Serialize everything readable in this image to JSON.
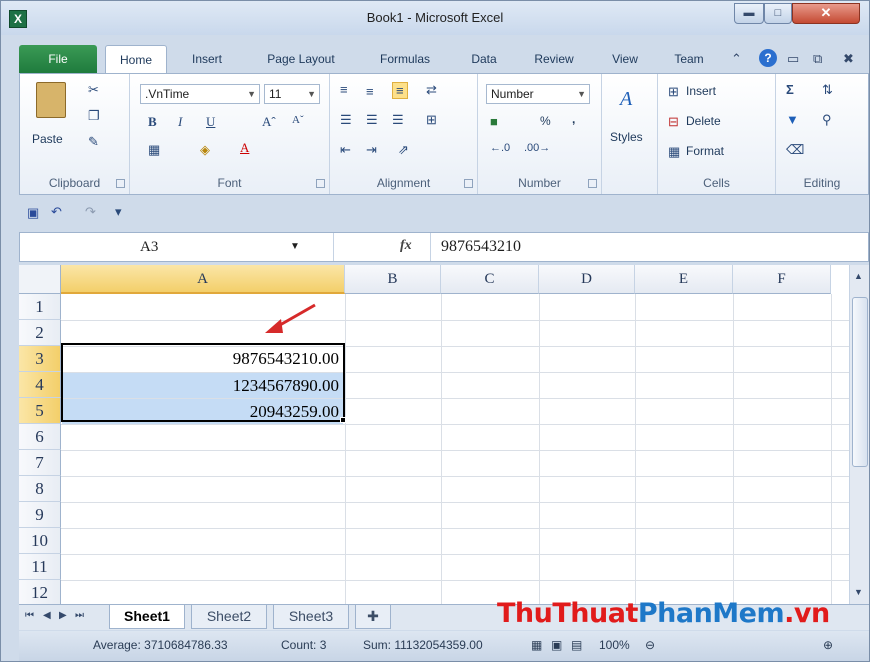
{
  "window": {
    "title": "Book1 - Microsoft Excel",
    "app_icon": "X"
  },
  "ribbon_tabs": [
    "File",
    "Home",
    "Insert",
    "Page Layout",
    "Formulas",
    "Data",
    "Review",
    "View",
    "Team"
  ],
  "ribbon": {
    "clipboard": {
      "label": "Clipboard",
      "paste": "Paste"
    },
    "font": {
      "label": "Font",
      "name": ".VnTime",
      "size": "11"
    },
    "alignment": {
      "label": "Alignment"
    },
    "number": {
      "label": "Number",
      "format": "Number",
      "percent": "%",
      "comma": ","
    },
    "styles": {
      "label": "Styles"
    },
    "cells": {
      "label": "Cells",
      "insert": "Insert",
      "delete": "Delete",
      "format": "Format"
    },
    "editing": {
      "label": "Editing"
    }
  },
  "formula_bar": {
    "name_box": "A3",
    "fx": "fx",
    "value": "9876543210"
  },
  "grid": {
    "columns": [
      "A",
      "B",
      "C",
      "D",
      "E",
      "F"
    ],
    "rows": [
      "1",
      "2",
      "3",
      "4",
      "5",
      "6",
      "7",
      "8",
      "9",
      "10",
      "11",
      "12"
    ],
    "cells": {
      "A3": "9876543210.00",
      "A4": "1234567890.00",
      "A5": "20943259.00"
    }
  },
  "sheets": [
    "Sheet1",
    "Sheet2",
    "Sheet3"
  ],
  "status": {
    "average": "Average: 3710684786.33",
    "count": "Count: 3",
    "sum": "Sum: 11132054359.00",
    "zoom": "100%"
  },
  "watermark": {
    "part1": "ThuThuat",
    "part2": "PhanMem",
    "part3": ".vn"
  },
  "colors": {
    "accent": "#1f7b3d",
    "selection_header": "#f3cf6a",
    "selection_fill": "#c5dcf5",
    "arrow": "#d62a2a"
  }
}
